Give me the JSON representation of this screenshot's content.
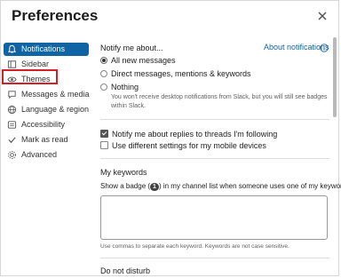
{
  "dialog": {
    "title": "Preferences"
  },
  "sidebar": {
    "items": [
      {
        "label": "Notifications",
        "icon": "bell-icon",
        "active": true
      },
      {
        "label": "Sidebar",
        "icon": "sidebar-icon"
      },
      {
        "label": "Themes",
        "icon": "eye-icon"
      },
      {
        "label": "Messages & media",
        "icon": "messages-icon"
      },
      {
        "label": "Language & region",
        "icon": "globe-icon"
      },
      {
        "label": "Accessibility",
        "icon": "accessibility-icon"
      },
      {
        "label": "Mark as read",
        "icon": "check-icon"
      },
      {
        "label": "Advanced",
        "icon": "gear-icon"
      }
    ]
  },
  "notify": {
    "title": "Notify me about...",
    "about_link": "About notifications",
    "options": [
      {
        "label": "All new messages",
        "checked": true
      },
      {
        "label": "Direct messages, mentions & keywords",
        "checked": false
      },
      {
        "label": "Nothing",
        "checked": false
      }
    ],
    "nothing_hint": "You won't receive desktop notifications from Slack, but you will still see badges within Slack."
  },
  "checkboxes": [
    {
      "label": "Notify me about replies to threads I'm following",
      "checked": true
    },
    {
      "label": "Use different settings for my mobile devices",
      "checked": false
    }
  ],
  "keywords": {
    "title": "My keywords",
    "desc_before": "Show a badge (",
    "badge": "1",
    "desc_after": ") in my channel list when someone uses one of my keywords:",
    "input_value": "",
    "hint": "Use commas to separate each keyword. Keywords are not case sensitive."
  },
  "dnd": {
    "title": "Do not disturb"
  },
  "colors": {
    "accent": "#1164a3",
    "link": "#1264a3",
    "highlight": "#d32027"
  }
}
